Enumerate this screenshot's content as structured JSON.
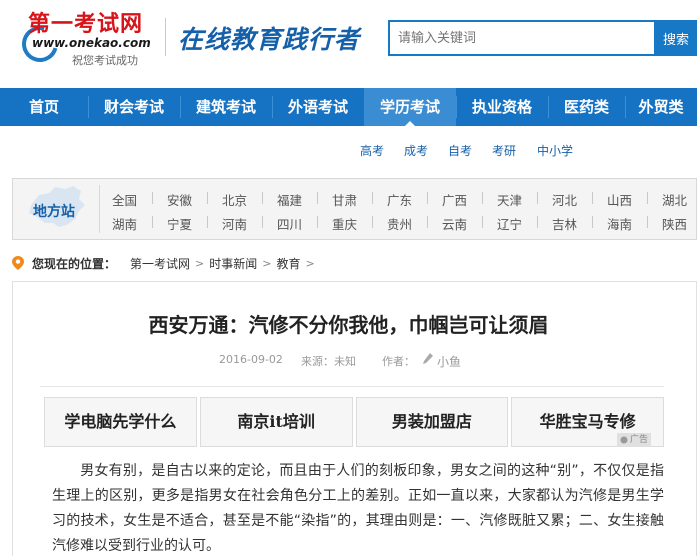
{
  "header": {
    "logo_text": "第一考试网",
    "logo_url_text": "www.onekao.com",
    "logo_slogan": "祝您考试成功",
    "tagline": "在线教育践行者",
    "search_placeholder": "请输入关键词",
    "search_button": "搜索"
  },
  "nav": {
    "items": [
      {
        "label": "首页"
      },
      {
        "label": "财会考试"
      },
      {
        "label": "建筑考试"
      },
      {
        "label": "外语考试"
      },
      {
        "label": "学历考试"
      },
      {
        "label": "执业资格"
      },
      {
        "label": "医药类"
      },
      {
        "label": "外贸类"
      }
    ],
    "active_index": 4
  },
  "subnav": {
    "items": [
      {
        "label": "高考"
      },
      {
        "label": "成考"
      },
      {
        "label": "自考"
      },
      {
        "label": "考研"
      },
      {
        "label": "中小学"
      }
    ]
  },
  "region": {
    "title": "地方站",
    "row1": [
      "全国",
      "安徽",
      "北京",
      "福建",
      "甘肃",
      "广东",
      "广西",
      "天津",
      "河北",
      "山西",
      "湖北"
    ],
    "row2": [
      "湖南",
      "宁夏",
      "河南",
      "四川",
      "重庆",
      "贵州",
      "云南",
      "辽宁",
      "吉林",
      "海南",
      "陕西"
    ]
  },
  "breadcrumb": {
    "label": "您现在的位置：",
    "items": [
      "第一考试网",
      "时事新闻",
      "教育"
    ]
  },
  "article": {
    "title": "西安万通：汽修不分你我他，巾帼岂可让须眉",
    "date": "2016-09-02",
    "source_label": "来源：",
    "source_value": "未知",
    "author_label": "作者：",
    "author_value": "小鱼",
    "body": "男女有别，是自古以来的定论，而且由于人们的刻板印象，男女之间的这种“别”，不仅仅是指生理上的区别，更多是指男女在社会角色分工上的差别。正如一直以来，大家都认为汽修是男生学习的技术，女生是不适合，甚至是不能“染指”的，其理由则是：一、汽修既脏又累；二、女生接触汽修难以受到行业的认可。"
  },
  "ads": {
    "items": [
      {
        "label": "学电脑先学什么"
      },
      {
        "label": "南京it培训"
      },
      {
        "label": "男装加盟店"
      },
      {
        "label": "华胜宝马专修"
      }
    ],
    "badge": "广告"
  },
  "colors": {
    "brand_blue": "#1673c4",
    "logo_red": "#d8131a"
  }
}
